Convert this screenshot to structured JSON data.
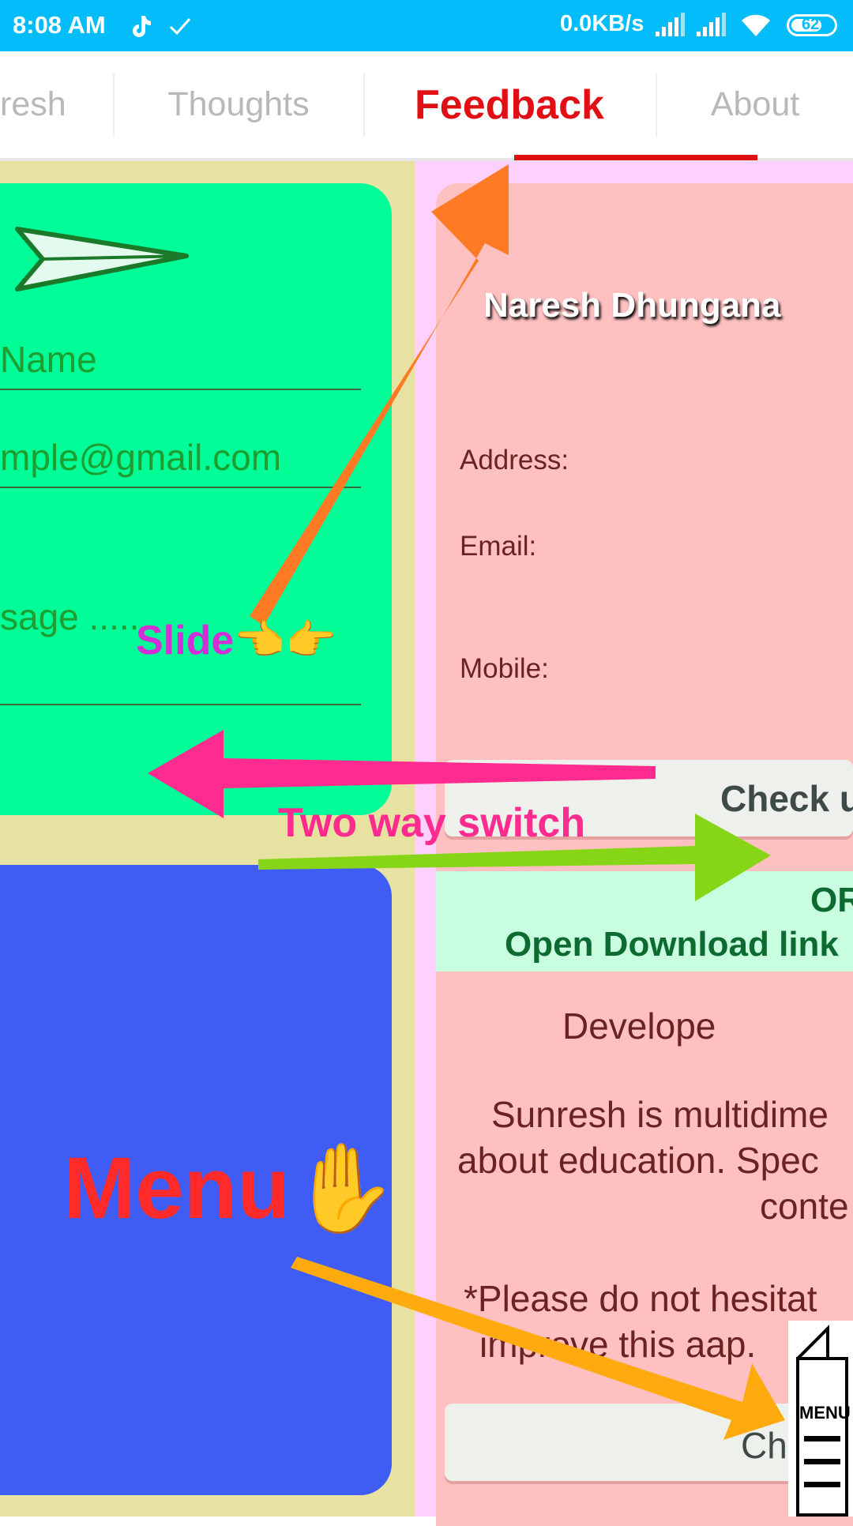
{
  "status_bar": {
    "time": "8:08 AM",
    "net_speed": "0.0KB/s",
    "battery": "62",
    "icons": [
      "tiktok-icon",
      "check-icon",
      "signal-icon",
      "signal-icon",
      "wifi-icon",
      "battery-icon"
    ]
  },
  "tabs": [
    {
      "label": "resh",
      "active": false
    },
    {
      "label": "Thoughts",
      "active": false
    },
    {
      "label": "Feedback",
      "active": true
    },
    {
      "label": "About",
      "active": false
    }
  ],
  "feedback_form": {
    "name_placeholder": "Name",
    "email_placeholder": "mple@gmail.com",
    "message_placeholder": "sage .....",
    "send_icon": "paper-plane-icon"
  },
  "about": {
    "name": "Naresh Dhungana",
    "address_label": "Address:",
    "email_label": "Email:",
    "mobile_label": "Mobile:",
    "check_button": "Check u",
    "or_text": "OR",
    "download_link": "Open Download link",
    "developer_heading": "Develope",
    "desc_line1": "Sunresh is multidime",
    "desc_line2": "about education. Spec",
    "desc_line3": "conte",
    "note_line1": "*Please do not hesitat",
    "note_line2": "improve this aap.",
    "bottom_button": "Ch"
  },
  "annotations": {
    "slide": "Slide👈👉",
    "two_way": "Two way switch",
    "menu": "Menu✋"
  },
  "menu_fab": {
    "label": "MENU",
    "icon": "menu-icon"
  },
  "colors": {
    "status_bar": "#03bdfa",
    "tab_active": "#e00f14",
    "form_card": "#00fd98",
    "menu_card": "#3f5cf4",
    "about_card": "#fec0c0",
    "arrow_orange": "#ff7a24",
    "arrow_pink": "#ff2b8e",
    "arrow_green": "#86d617",
    "arrow_amber": "#ffab0f"
  }
}
